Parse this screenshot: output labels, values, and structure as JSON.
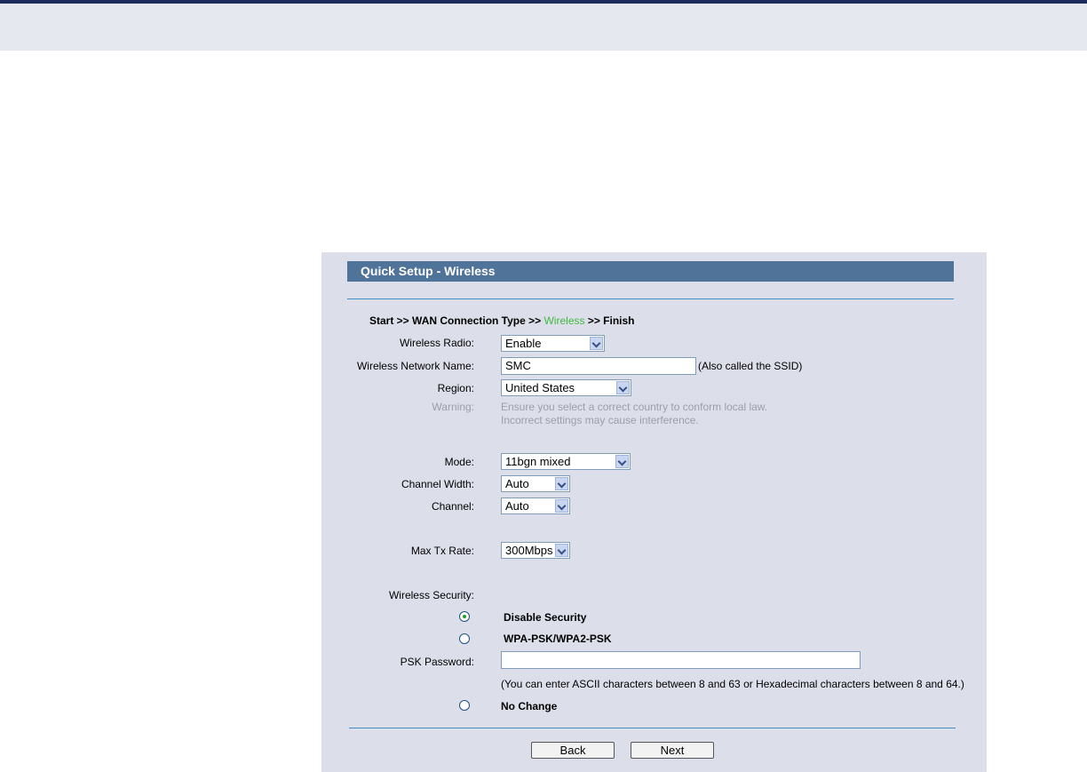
{
  "panel": {
    "title": "Quick Setup - Wireless"
  },
  "breadcrumb": {
    "prefix": "Start >> WAN Connection Type >> ",
    "current": "Wireless",
    "suffix": " >> Finish"
  },
  "form": {
    "wireless_radio": {
      "label": "Wireless Radio:",
      "value": "Enable"
    },
    "network_name": {
      "label": "Wireless Network Name:",
      "value": "SMC",
      "hint": "(Also called the SSID)"
    },
    "region": {
      "label": "Region:",
      "value": "United States"
    },
    "warning": {
      "label": "Warning:",
      "line1": "Ensure you select a correct country to conform local law.",
      "line2": "Incorrect settings may cause interference."
    },
    "mode": {
      "label": "Mode:",
      "value": "11bgn mixed"
    },
    "channel_width": {
      "label": "Channel Width:",
      "value": "Auto"
    },
    "channel": {
      "label": "Channel:",
      "value": "Auto"
    },
    "max_tx_rate": {
      "label": "Max Tx Rate:",
      "value": "300Mbps"
    },
    "security": {
      "label": "Wireless Security:",
      "options": [
        {
          "label": "Disable Security",
          "checked": true
        },
        {
          "label": "WPA-PSK/WPA2-PSK",
          "checked": false
        },
        {
          "label": "No Change",
          "checked": false
        }
      ],
      "psk_label": "PSK Password:",
      "psk_value": "",
      "psk_hint": "(You can enter ASCII characters between 8 and 63 or Hexadecimal characters between 8 and 64.)"
    }
  },
  "buttons": {
    "back": "Back",
    "next": "Next"
  },
  "colors": {
    "title_bg": "#50739a",
    "panel_bg": "#dcdfe9",
    "accent_green": "#40b840"
  }
}
